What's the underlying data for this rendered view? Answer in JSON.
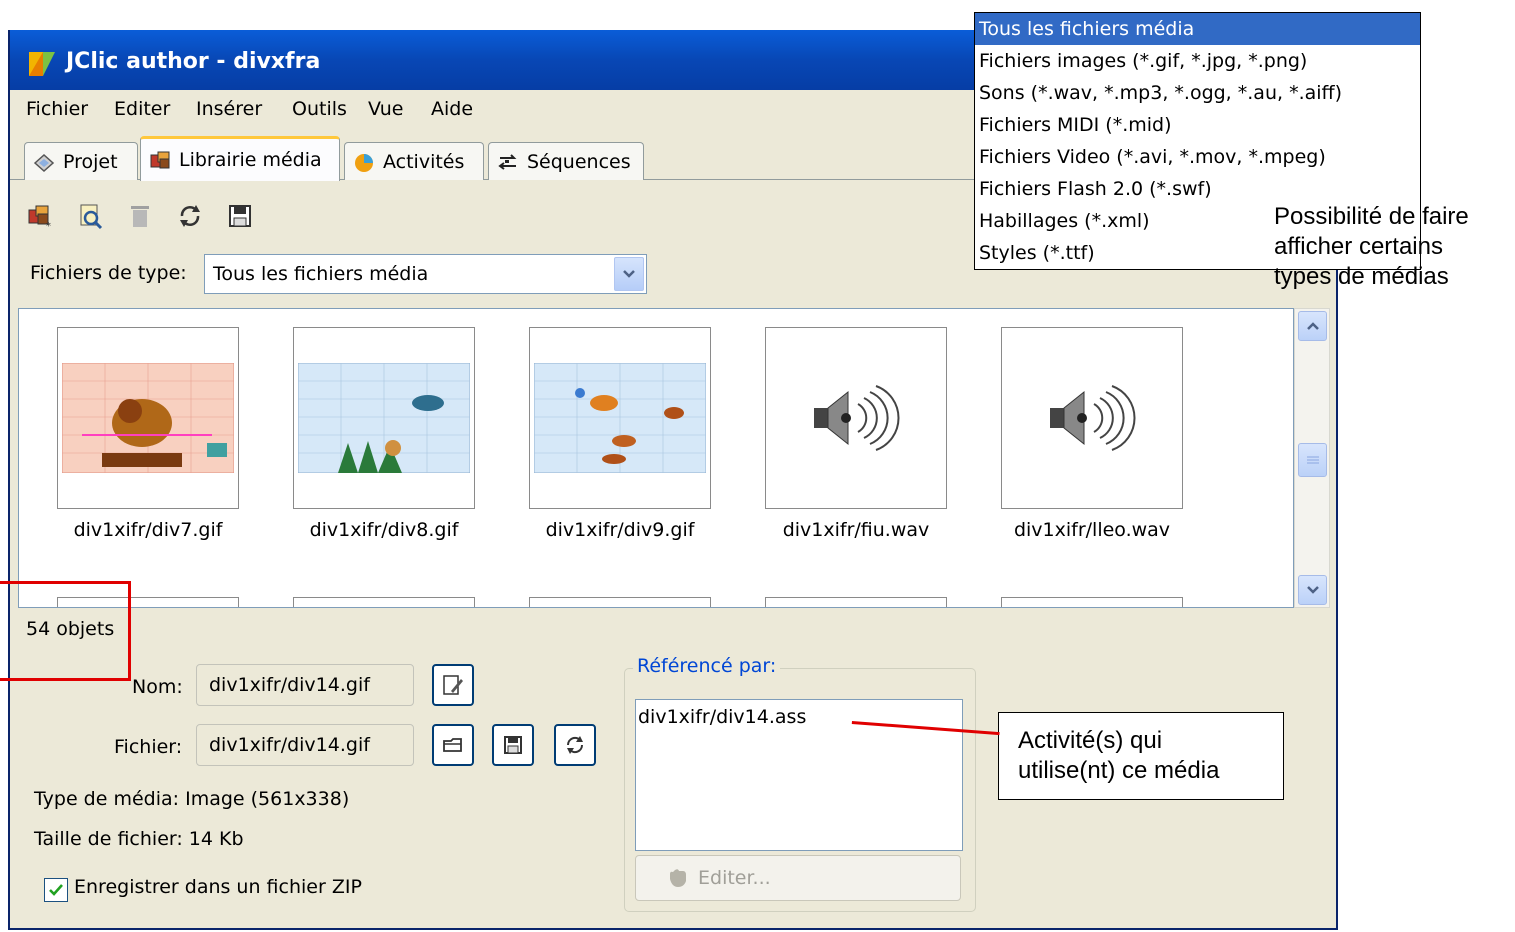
{
  "window": {
    "title": "JClic author - divxfra"
  },
  "menubar": {
    "items": [
      "Fichier",
      "Editer",
      "Insérer",
      "Outils",
      "Vue",
      "Aide"
    ]
  },
  "tabs": [
    {
      "label": "Projet",
      "icon": "project-icon"
    },
    {
      "label": "Librairie média",
      "icon": "media-library-icon"
    },
    {
      "label": "Activités",
      "icon": "activities-icon"
    },
    {
      "label": "Séquences",
      "icon": "sequences-icon"
    }
  ],
  "active_tab": "Librairie média",
  "toolbar": {
    "icons": [
      "add-media-icon",
      "preview-icon",
      "delete-icon",
      "update-icon",
      "export-icon"
    ]
  },
  "filter": {
    "label": "Fichiers de type:",
    "value": "Tous les fichiers média"
  },
  "gallery": {
    "items": [
      {
        "label": "div1xifr/div7.gif",
        "kind": "image"
      },
      {
        "label": "div1xifr/div8.gif",
        "kind": "image"
      },
      {
        "label": "div1xifr/div9.gif",
        "kind": "image"
      },
      {
        "label": "div1xifr/fiu.wav",
        "kind": "sound"
      },
      {
        "label": "div1xifr/lleo.wav",
        "kind": "sound"
      }
    ]
  },
  "status": {
    "count": "54 objets"
  },
  "details": {
    "name_label": "Nom:",
    "name_value": "div1xifr/div14.gif",
    "file_label": "Fichier:",
    "file_value": "div1xifr/div14.gif",
    "type_text": "Type de média: Image (561x338)",
    "size_text": "Taille de fichier: 14 Kb",
    "zip_label": "Enregistrer dans un fichier ZIP",
    "zip_checked": true
  },
  "referenced": {
    "legend": "Référencé par:",
    "items": [
      "div1xifr/div14.ass"
    ],
    "edit_label": "Editer..."
  },
  "dropdown_popup": {
    "options": [
      "Tous les fichiers média",
      "Fichiers images (*.gif, *.jpg, *.png)",
      "Sons (*.wav, *.mp3, *.ogg, *.au, *.aiff)",
      "Fichiers MIDI (*.mid)",
      "Fichiers Video (*.avi, *.mov, *.mpeg)",
      "Fichiers Flash 2.0 (*.swf)",
      "Habillages (*.xml)",
      "Styles (*.ttf)"
    ],
    "selected": "Tous les fichiers média"
  },
  "annotations": {
    "types_note": [
      "Possibilité de faire",
      "afficher certains",
      "types de médias"
    ],
    "usage_note": [
      "Activité(s) qui",
      "utilise(nt) ce média"
    ]
  },
  "colors": {
    "titlebar": "#0A5DD8",
    "selection": "#316AC5",
    "annotation_line": "#E00000",
    "window_bg": "#ECE9D8"
  }
}
